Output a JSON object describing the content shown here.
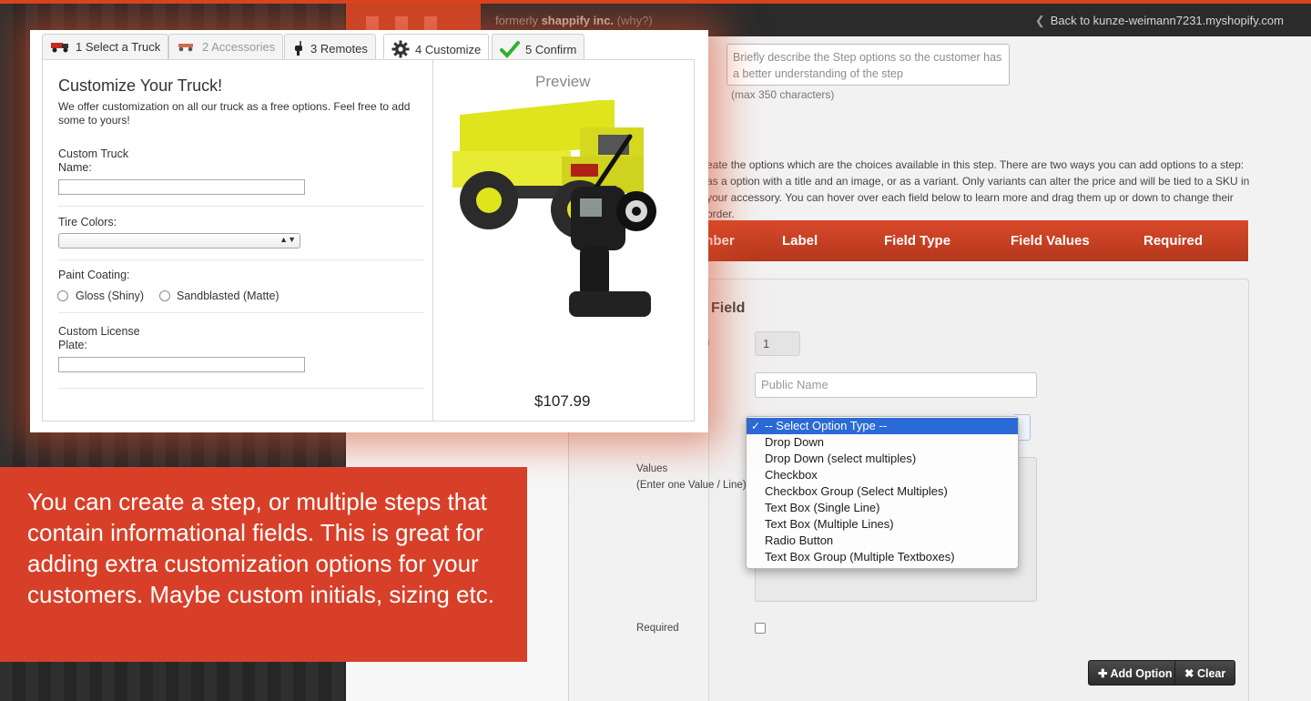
{
  "topbar": {
    "formerly_text": "formerly",
    "brand_text": "shappify inc.",
    "why_text": "(why?)",
    "back_text": "Back to kunze-weimann7231.myshopify.com"
  },
  "step": {
    "desc_placeholder": "Briefly describe the Step options so the customer has a better understanding of the step",
    "max_chars": "(max 350 characters)",
    "intro": "eate the options which are the choices available in this step. There are two ways you can add options to a step: as a option with a title and an image, or as a variant. Only variants can alter the price and will be tied to a SKU in your accessory. You can hover over each field below to learn more and drag them up or down to change their order."
  },
  "field_table": {
    "headers": [
      "mber",
      "Label",
      "Field Type",
      "Field Values",
      "Required"
    ]
  },
  "add_field": {
    "title": "Field",
    "paren_fragment": ")",
    "id_value": "1",
    "public_name_placeholder": "Public Name",
    "values_label": "Values",
    "values_hint": "(Enter one Value / Line)",
    "required_label": "Required",
    "add_option_label": "Add Option",
    "clear_label": "Clear"
  },
  "option_type_menu": {
    "items": [
      "-- Select Option Type --",
      "Drop Down",
      "Drop Down (select multiples)",
      "Checkbox",
      "Checkbox Group (Select Multiples)",
      "Text Box (Single Line)",
      "Text Box (Multiple Lines)",
      "Radio Button",
      "Text Box Group (Multiple Textboxes)"
    ],
    "selected_index": 0
  },
  "wizard": {
    "tabs": [
      {
        "label": "1 Select a Truck",
        "icon": "truck-icon"
      },
      {
        "label": "2 Accessories",
        "icon": "truck-accessory-icon"
      },
      {
        "label": "3 Remotes",
        "icon": "remote-icon"
      },
      {
        "label": "4 Customize",
        "icon": "gear-icon"
      },
      {
        "label": "5 Confirm",
        "icon": "checkmark-icon"
      }
    ],
    "form_title": "Customize Your Truck!",
    "form_desc": "We offer customization on all our truck as a free options. Feel free to add some to yours!",
    "custom_name_label": "Custom Truck Name:",
    "tire_colors_label": "Tire Colors:",
    "paint_label": "Paint Coating:",
    "paint_options": [
      "Gloss (Shiny)",
      "Sandblasted (Matte)"
    ],
    "plate_label": "Custom License Plate:",
    "preview_title": "Preview",
    "price": "$107.99"
  },
  "callout": {
    "text": "You can create a step, or multiple steps that contain informational fields. This is great for adding extra customization options for your customers. Maybe custom initials, sizing etc."
  },
  "colors": {
    "accent_red": "#d83f28",
    "header_red": "#c94324",
    "selected_blue": "#2a6ad6"
  }
}
